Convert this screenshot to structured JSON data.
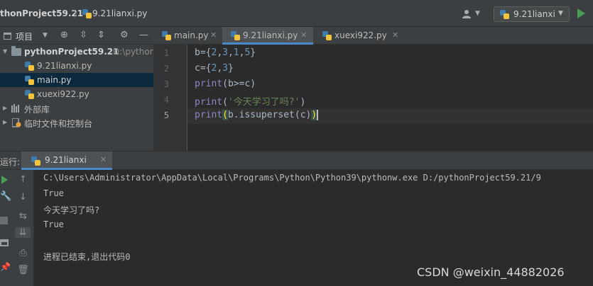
{
  "navbar": {
    "project": "thonProject59.21",
    "separator": "〉",
    "file": "9.21lianxi.py",
    "run_config": "9.21lianxi"
  },
  "project_panel": {
    "title": "项目",
    "tree": [
      {
        "label": "pythonProject59.21",
        "path_hint": "D:\\python",
        "expanded": true
      },
      {
        "label": "9.21lianxi.py"
      },
      {
        "label": "main.py",
        "selected": true
      },
      {
        "label": "xuexi922.py"
      },
      {
        "label": "外部库",
        "expanded": false
      },
      {
        "label": "临时文件和控制台",
        "expanded": false
      }
    ]
  },
  "editor": {
    "tabs": [
      {
        "label": "main.py",
        "active": false
      },
      {
        "label": "9.21lianxi.py",
        "active": true
      },
      {
        "label": "xuexi922.py",
        "active": false
      }
    ],
    "line_numbers": [
      "1",
      "2",
      "3",
      "4",
      "5"
    ],
    "code": {
      "l1": {
        "var": "b={",
        "n1": "2",
        "c1": ",",
        "n2": "3",
        "c2": ",",
        "n3": "1",
        "c3": ",",
        "n4": "5",
        "end": "}"
      },
      "l2": {
        "var": "c={",
        "n1": "2",
        "c1": ",",
        "n2": "3",
        "end": "}"
      },
      "l3": {
        "fn": "print",
        "rest": "(b>=c)"
      },
      "l4": {
        "fn": "print",
        "open": "(",
        "str": "'今天学习了吗?'",
        "close": ")"
      },
      "l5": {
        "fn": "print",
        "open": "(",
        "mid": "b.issuperset(c)",
        "close": ")"
      }
    }
  },
  "run_panel": {
    "title": "运行:",
    "tab": "9.21lianxi",
    "output": [
      "C:\\Users\\Administrator\\AppData\\Local\\Programs\\Python\\Python39\\pythonw.exe D:/pythonProject59.21/9",
      "True",
      "今天学习了吗?",
      "True",
      "",
      "进程已结束,退出代码0"
    ]
  },
  "watermark": "CSDN @weixin_44882026",
  "colors": {
    "accent": "#4a88c7",
    "run_green": "#499c54",
    "selection": "#0d293e"
  }
}
